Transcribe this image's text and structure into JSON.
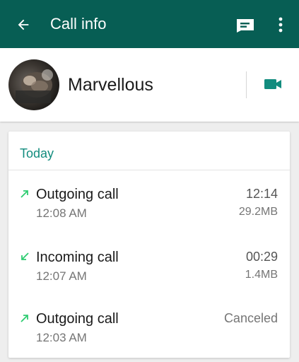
{
  "appbar": {
    "title": "Call info",
    "back_icon": "arrow-left-icon",
    "message_icon": "message-icon",
    "more_icon": "more-vertical-icon",
    "background": "#075e54"
  },
  "contact": {
    "name": "Marvellous",
    "video_icon": "videocam-icon",
    "accent": "#128c7e"
  },
  "calls": {
    "header": "Today",
    "items": [
      {
        "type": "Outgoing call",
        "direction": "outgoing",
        "time": "12:08 AM",
        "duration": "12:14",
        "size": "29.2MB"
      },
      {
        "type": "Incoming call",
        "direction": "incoming",
        "time": "12:07 AM",
        "duration": "00:29",
        "size": "1.4MB"
      },
      {
        "type": "Outgoing call",
        "direction": "outgoing",
        "time": "12:03 AM",
        "status": "Canceled"
      }
    ],
    "arrow_color": "#2ecc71"
  }
}
